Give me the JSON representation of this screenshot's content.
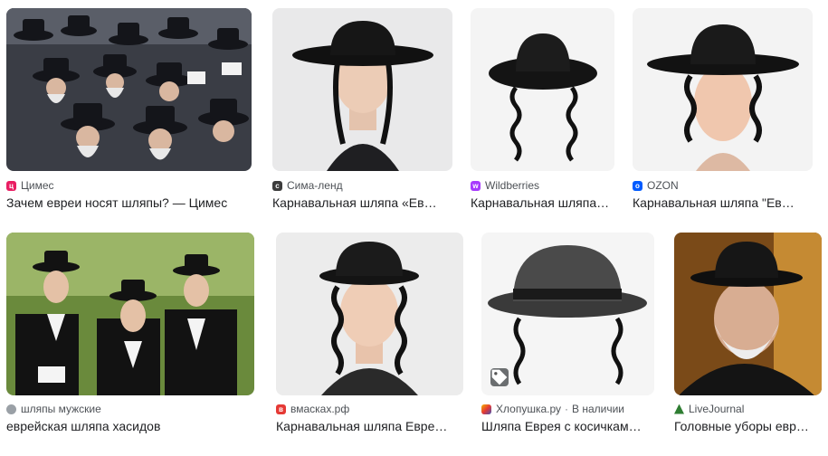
{
  "results": [
    {
      "source": "Цимес",
      "title": "Зачем евреи носят шляпы? — Цимес",
      "favicon": "tsimes-icon",
      "favicon_color": "#e91e63"
    },
    {
      "source": "Сима-ленд",
      "title": "Карнавальная шляпа «Ев…",
      "favicon": "sima-land-icon",
      "favicon_color": "#3c3c3c"
    },
    {
      "source": "Wildberries",
      "title": "Карнавальная шляпа…",
      "favicon": "wildberries-icon",
      "favicon_color": "#a73afd"
    },
    {
      "source": "OZON",
      "title": "Карнавальная шляпа \"Ев…",
      "favicon": "ozon-icon",
      "favicon_color": "#005bff"
    },
    {
      "source": "шляпы мужские",
      "title": "еврейская шляпа хасидов",
      "favicon": "globe-icon",
      "favicon_color": "#9aa0a6"
    },
    {
      "source": "вмасках.рф",
      "title": "Карнавальная шляпа Евре…",
      "favicon": "vmaskah-icon",
      "favicon_color": "#e53935"
    },
    {
      "source": "Хлопушка.ру",
      "availability": "В наличии",
      "title": "Шляпа Еврея с косичкам…",
      "favicon": "hlopushka-icon",
      "favicon_color": "#f4b400"
    },
    {
      "source": "LiveJournal",
      "title": "Головные уборы евр…",
      "favicon": "livejournal-icon",
      "favicon_color": "#2e7d32"
    }
  ],
  "colors": {
    "accent": "#202124",
    "muted": "#4d5156"
  }
}
